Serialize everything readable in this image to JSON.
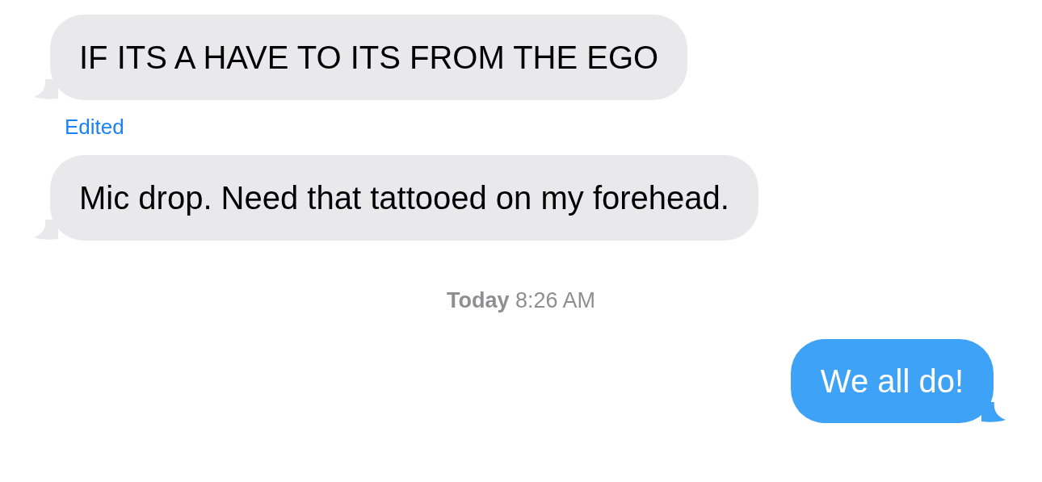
{
  "messages": [
    {
      "kind": "received",
      "text": "IF ITS A HAVE TO ITS FROM THE EGO"
    },
    {
      "kind": "edited",
      "text": "Edited"
    },
    {
      "kind": "received",
      "text": "Mic drop. Need that tattooed on my forehead."
    },
    {
      "kind": "timestamp",
      "text": "**Today** 8:26 AM"
    },
    {
      "kind": "sent",
      "text": "We all do!"
    }
  ]
}
